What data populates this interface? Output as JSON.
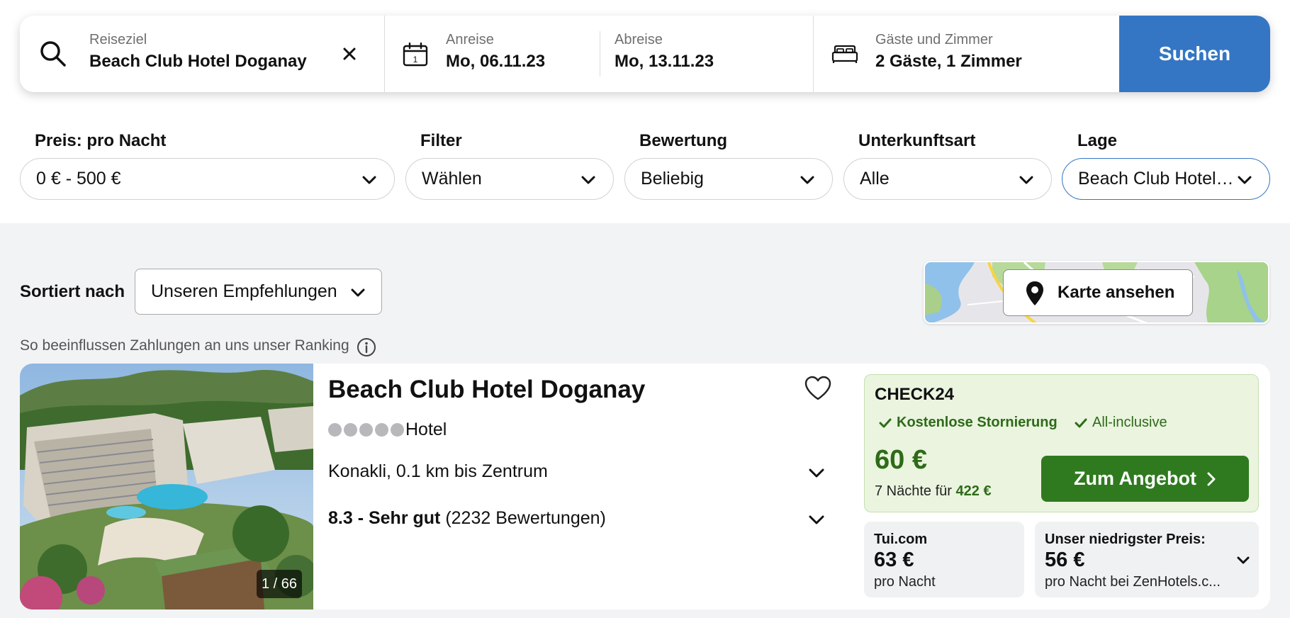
{
  "search": {
    "destination_label": "Reiseziel",
    "destination_value": "Beach Club Hotel Doganay",
    "checkin_label": "Anreise",
    "checkin_value": "Mo, 06.11.23",
    "checkout_label": "Abreise",
    "checkout_value": "Mo, 13.11.23",
    "guests_label": "Gäste und Zimmer",
    "guests_value": "2 Gäste, 1 Zimmer",
    "search_button": "Suchen",
    "icons": [
      "search-icon",
      "clear-icon",
      "calendar-icon",
      "bed-icon"
    ]
  },
  "filters": {
    "price": {
      "label": "Preis: pro Nacht",
      "value": "0 € - 500 €"
    },
    "filter": {
      "label": "Filter",
      "value": "Wählen"
    },
    "rating": {
      "label": "Bewertung",
      "value": "Beliebig"
    },
    "type": {
      "label": "Unterkunftsart",
      "value": "Alle"
    },
    "location": {
      "label": "Lage",
      "value": "Beach Club Hotel…"
    }
  },
  "sort": {
    "label": "Sortiert nach",
    "value": "Unseren Empfehlungen"
  },
  "map": {
    "button": "Karte ansehen"
  },
  "ranking_note": "So beeinflussen Zahlungen an uns unser Ranking",
  "hotel": {
    "name": "Beach Club Hotel Doganay",
    "type": "Hotel",
    "stars_shown": 5,
    "location": "Konakli, 0.1 km bis Zentrum",
    "rating_score": "8.3 - Sehr gut",
    "rating_count": "(2232 Bewertungen)",
    "photo_counter": "1 / 66"
  },
  "main_offer": {
    "provider": "CHECK24",
    "feature_1": "Kostenlose Stornierung",
    "feature_2": "All-inclusive",
    "price": "60 €",
    "nights_text": "7 Nächte für",
    "total": "422 €",
    "button": "Zum Angebot"
  },
  "offer_tui": {
    "provider": "Tui.com",
    "price": "63 €",
    "sub": "pro Nacht"
  },
  "offer_lowest": {
    "provider": "Unser niedrigster Preis:",
    "price": "56 €",
    "sub": "pro Nacht bei ZenHotels.c..."
  },
  "colors": {
    "accent_blue": "#3476c4",
    "offer_green": "#2f7a1f",
    "offer_bg": "#eaf4df"
  }
}
